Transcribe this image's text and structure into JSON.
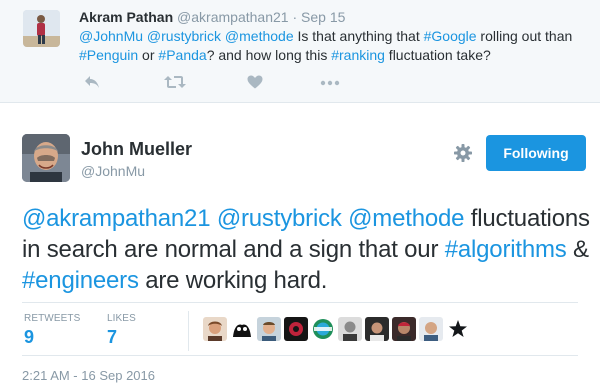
{
  "parent_tweet": {
    "name": "Akram Pathan",
    "handle": "@akrampathan21",
    "separator": "·",
    "time": "Sep 15",
    "text_segments": [
      {
        "text": "@JohnMu",
        "link": true
      },
      {
        "text": " ",
        "link": false
      },
      {
        "text": "@rustybrick",
        "link": true
      },
      {
        "text": " ",
        "link": false
      },
      {
        "text": "@methode",
        "link": true
      },
      {
        "text": " Is that anything that ",
        "link": false
      },
      {
        "text": "#Google",
        "link": true
      },
      {
        "text": " rolling out than ",
        "link": false
      },
      {
        "text": "#Penguin",
        "link": true
      },
      {
        "text": " or ",
        "link": false
      },
      {
        "text": "#Panda",
        "link": true
      },
      {
        "text": "? and how long this ",
        "link": false
      },
      {
        "text": "#ranking",
        "link": true
      },
      {
        "text": " fluctuation take?",
        "link": false
      }
    ],
    "actions": [
      "reply-icon",
      "retweet-icon",
      "like-icon",
      "more-icon"
    ]
  },
  "main_tweet": {
    "name": "John Mueller",
    "handle": "@JohnMu",
    "follow_label": "Following",
    "text_segments": [
      {
        "text": "@akrampathan21",
        "link": true
      },
      {
        "text": " ",
        "link": false
      },
      {
        "text": "@rustybrick",
        "link": true
      },
      {
        "text": " ",
        "link": false
      },
      {
        "text": "@methode",
        "link": true
      },
      {
        "text": " fluctuations in search are normal and a sign that our ",
        "link": false
      },
      {
        "text": "#algorithms",
        "link": true
      },
      {
        "text": " & ",
        "link": false
      },
      {
        "text": "#engineers",
        "link": true
      },
      {
        "text": " are working hard.",
        "link": false
      }
    ],
    "stats": {
      "retweets_label": "RETWEETS",
      "retweets_value": "9",
      "likes_label": "LIKES",
      "likes_value": "7"
    },
    "timestamp": "2:21 AM - 16 Sep 2016"
  },
  "colors": {
    "link": "#1b95e0",
    "muted": "#8899a6",
    "text": "#292f33",
    "button": "#1b95e0",
    "parent_bg": "#f5f8fa"
  }
}
